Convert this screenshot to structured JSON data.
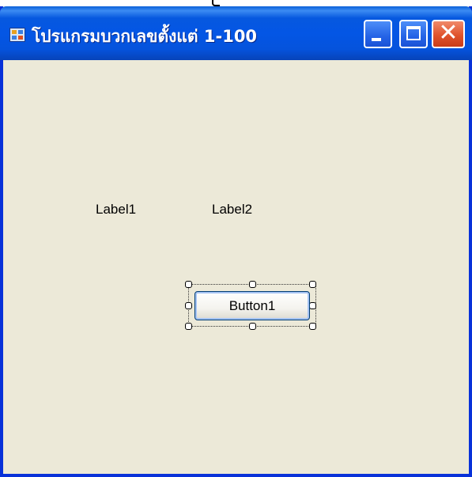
{
  "window": {
    "title": "โปรแกรมบวกเลขตั้งแต่ 1-100",
    "accent_color": "#0831d9",
    "client_background": "#ece9d8"
  },
  "caption_buttons": {
    "minimize_icon": "minimize-icon",
    "maximize_icon": "maximize-icon",
    "close_glyph": "✕",
    "close_color": "#e0532c"
  },
  "form": {
    "label1": "Label1",
    "label2": "Label2",
    "button1": "Button1"
  }
}
